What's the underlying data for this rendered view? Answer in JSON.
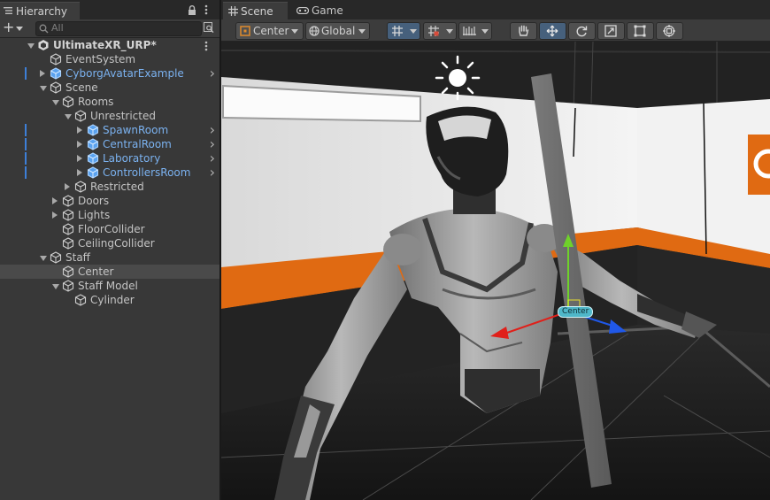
{
  "hierarchy": {
    "tab_label": "Hierarchy",
    "search_placeholder": "All",
    "add_label": "+",
    "rows": [
      {
        "label": "UltimateXR_URP*",
        "style": "bold",
        "expander": "down",
        "icon": "unity-scene",
        "depth": 0
      },
      {
        "label": "EventSystem",
        "style": "plain",
        "expander": "none",
        "icon": "gameobject",
        "depth": 1
      },
      {
        "label": "CyborgAvatarExample",
        "style": "prefab",
        "expander": "right",
        "icon": "prefab-variant",
        "depth": 1,
        "goto": true
      },
      {
        "label": "Scene",
        "style": "plain",
        "expander": "down",
        "icon": "gameobject",
        "depth": 1
      },
      {
        "label": "Rooms",
        "style": "plain",
        "expander": "down",
        "icon": "gameobject",
        "depth": 2
      },
      {
        "label": "Unrestricted",
        "style": "plain",
        "expander": "down",
        "icon": "gameobject",
        "depth": 3
      },
      {
        "label": "SpawnRoom",
        "style": "prefab",
        "expander": "right",
        "icon": "prefab",
        "depth": 4,
        "goto": true
      },
      {
        "label": "CentralRoom",
        "style": "prefab",
        "expander": "right",
        "icon": "prefab",
        "depth": 4,
        "goto": true
      },
      {
        "label": "Laboratory",
        "style": "prefab",
        "expander": "right",
        "icon": "prefab",
        "depth": 4,
        "goto": true
      },
      {
        "label": "ControllersRoom",
        "style": "prefab",
        "expander": "right",
        "icon": "prefab",
        "depth": 4,
        "goto": true
      },
      {
        "label": "Restricted",
        "style": "plain",
        "expander": "right",
        "icon": "gameobject",
        "depth": 3
      },
      {
        "label": "Doors",
        "style": "plain",
        "expander": "right",
        "icon": "gameobject",
        "depth": 2
      },
      {
        "label": "Lights",
        "style": "plain",
        "expander": "right",
        "icon": "gameobject",
        "depth": 2
      },
      {
        "label": "FloorCollider",
        "style": "plain",
        "expander": "none",
        "icon": "gameobject",
        "depth": 2
      },
      {
        "label": "CeilingCollider",
        "style": "plain",
        "expander": "none",
        "icon": "gameobject",
        "depth": 2
      },
      {
        "label": "Staff",
        "style": "plain",
        "expander": "down",
        "icon": "gameobject",
        "depth": 1
      },
      {
        "label": "Center",
        "style": "plain",
        "expander": "none",
        "icon": "gameobject",
        "depth": 2,
        "selected": true
      },
      {
        "label": "Staff Model",
        "style": "plain",
        "expander": "down",
        "icon": "gameobject",
        "depth": 2
      },
      {
        "label": "Cylinder",
        "style": "plain",
        "expander": "none",
        "icon": "gameobject",
        "depth": 3
      }
    ]
  },
  "scene": {
    "tabs": [
      {
        "label": "Scene",
        "icon": "grid-icon"
      },
      {
        "label": "Game",
        "icon": "gamepad-icon"
      }
    ],
    "toolbar": {
      "pivot_label": "Center",
      "space_label": "Global"
    },
    "gizmo_label": "Center"
  },
  "colors": {
    "prefab_text": "#7bb2f0",
    "accent_orange": "#e06a12",
    "selection_row": "#4a4a4a",
    "active_tool": "#46607c"
  }
}
